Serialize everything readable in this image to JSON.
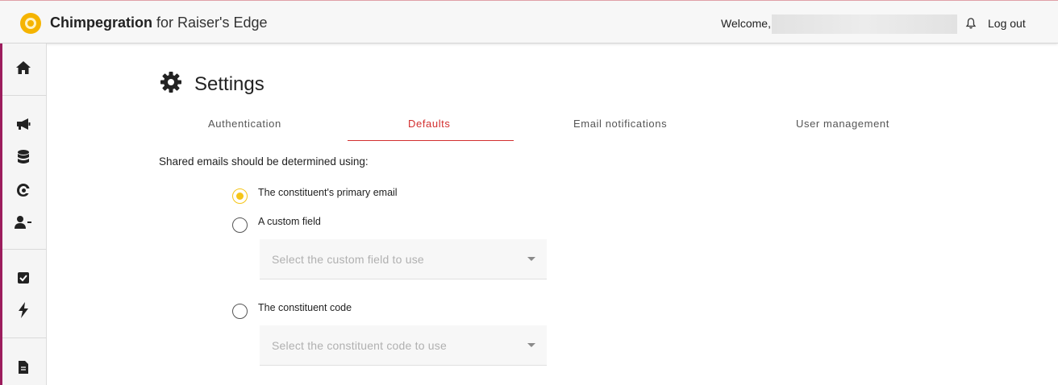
{
  "header": {
    "app_name": "Chimpegration",
    "app_suffix": " for Raiser's Edge",
    "welcome": "Welcome,",
    "logout": "Log out"
  },
  "sidebar": {
    "items": [
      {
        "icon": "home-icon"
      },
      {
        "icon": "megaphone-icon"
      },
      {
        "icon": "database-icon"
      },
      {
        "icon": "mailchimp-icon"
      },
      {
        "icon": "user-minus-icon"
      },
      {
        "icon": "checkbox-icon"
      },
      {
        "icon": "bolt-icon"
      },
      {
        "icon": "document-icon"
      }
    ]
  },
  "page": {
    "title": "Settings"
  },
  "tabs": [
    {
      "label": "Authentication",
      "active": false
    },
    {
      "label": "Defaults",
      "active": true
    },
    {
      "label": "Email notifications",
      "active": false
    },
    {
      "label": "User management",
      "active": false
    }
  ],
  "defaults": {
    "question": "Shared emails should be determined using:",
    "options": [
      {
        "label": "The constituent's primary email",
        "checked": true
      },
      {
        "label": "A custom field",
        "checked": false
      },
      {
        "label": "The constituent code",
        "checked": false
      }
    ],
    "custom_field_placeholder": "Select the custom field to use",
    "constituent_code_placeholder": "Select the constituent code to use"
  },
  "colors": {
    "accent_red": "#d32f2f",
    "sidebar_accent": "#9c1d5d",
    "radio_selected": "#f5c518",
    "logo": "#f5b400"
  }
}
